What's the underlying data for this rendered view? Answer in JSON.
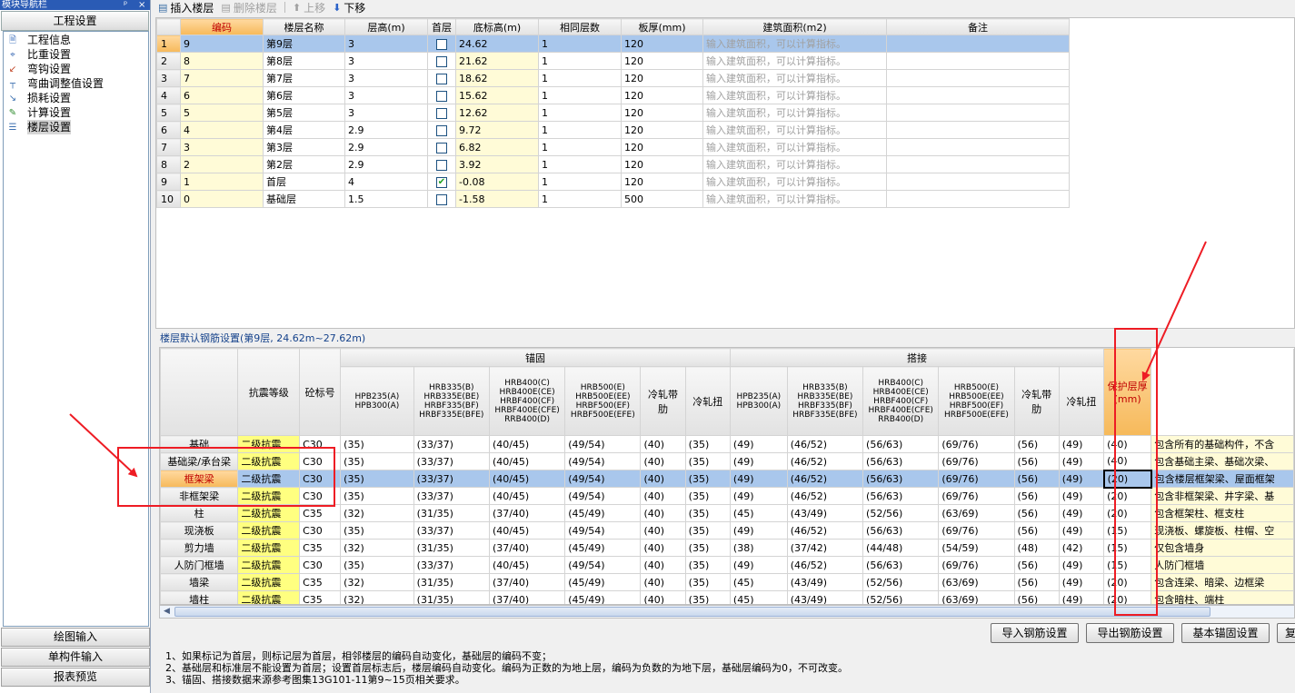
{
  "nav": {
    "title": "模块导航栏",
    "controls": [
      "ᵖ",
      "×"
    ],
    "header": "工程设置",
    "items": [
      {
        "label": "工程信息",
        "icon": "info-icon"
      },
      {
        "label": "比重设置",
        "icon": "ruler-icon"
      },
      {
        "label": "弯钩设置",
        "icon": "hook-icon"
      },
      {
        "label": "弯曲调整值设置",
        "icon": "bend-icon"
      },
      {
        "label": "损耗设置",
        "icon": "loss-icon"
      },
      {
        "label": "计算设置",
        "icon": "calc-icon"
      },
      {
        "label": "楼层设置",
        "icon": "floors-icon"
      }
    ],
    "bottom_buttons": [
      "绘图输入",
      "单构件输入",
      "报表预览"
    ]
  },
  "toolbar": {
    "insert": "插入楼层",
    "delete": "删除楼层",
    "up": "上移",
    "down": "下移"
  },
  "floor_table": {
    "headers": [
      "编码",
      "楼层名称",
      "层高(m)",
      "首层",
      "底标高(m)",
      "相同层数",
      "板厚(mm)",
      "建筑面积(m2)",
      "备注"
    ],
    "rows": [
      {
        "n": "1",
        "code": "9",
        "name": "第9层",
        "height": "3",
        "first": false,
        "base": "24.62",
        "same": "1",
        "slab": "120",
        "area": "输入建筑面积，可以计算指标。",
        "note": ""
      },
      {
        "n": "2",
        "code": "8",
        "name": "第8层",
        "height": "3",
        "first": false,
        "base": "21.62",
        "same": "1",
        "slab": "120",
        "area": "输入建筑面积，可以计算指标。",
        "note": ""
      },
      {
        "n": "3",
        "code": "7",
        "name": "第7层",
        "height": "3",
        "first": false,
        "base": "18.62",
        "same": "1",
        "slab": "120",
        "area": "输入建筑面积，可以计算指标。",
        "note": ""
      },
      {
        "n": "4",
        "code": "6",
        "name": "第6层",
        "height": "3",
        "first": false,
        "base": "15.62",
        "same": "1",
        "slab": "120",
        "area": "输入建筑面积，可以计算指标。",
        "note": ""
      },
      {
        "n": "5",
        "code": "5",
        "name": "第5层",
        "height": "3",
        "first": false,
        "base": "12.62",
        "same": "1",
        "slab": "120",
        "area": "输入建筑面积，可以计算指标。",
        "note": ""
      },
      {
        "n": "6",
        "code": "4",
        "name": "第4层",
        "height": "2.9",
        "first": false,
        "base": "9.72",
        "same": "1",
        "slab": "120",
        "area": "输入建筑面积，可以计算指标。",
        "note": ""
      },
      {
        "n": "7",
        "code": "3",
        "name": "第3层",
        "height": "2.9",
        "first": false,
        "base": "6.82",
        "same": "1",
        "slab": "120",
        "area": "输入建筑面积，可以计算指标。",
        "note": ""
      },
      {
        "n": "8",
        "code": "2",
        "name": "第2层",
        "height": "2.9",
        "first": false,
        "base": "3.92",
        "same": "1",
        "slab": "120",
        "area": "输入建筑面积，可以计算指标。",
        "note": ""
      },
      {
        "n": "9",
        "code": "1",
        "name": "首层",
        "height": "4",
        "first": true,
        "base": "-0.08",
        "same": "1",
        "slab": "120",
        "area": "输入建筑面积，可以计算指标。",
        "note": ""
      },
      {
        "n": "10",
        "code": "0",
        "name": "基础层",
        "height": "1.5",
        "first": false,
        "base": "-1.58",
        "same": "1",
        "slab": "500",
        "area": "输入建筑面积，可以计算指标。",
        "note": ""
      }
    ]
  },
  "rebar": {
    "title": "楼层默认钢筋设置(第9层, 24.62m~27.62m)",
    "group_anchor": "锚固",
    "group_lap": "搭接",
    "col_seismic": "抗震等级",
    "col_concrete": "砼标号",
    "col_cover": "保护层厚(mm)",
    "sub_headers": [
      "HPB235(A) HPB300(A)",
      "HRB335(B) HRB335E(BE) HRBF335(BF) HRBF335E(BFE)",
      "HRB400(C) HRB400E(CE) HRBF400(CF) HRBF400E(CFE) RRB400(D)",
      "HRB500(E) HRB500E(EE) HRBF500(EF) HRBF500E(EFE)",
      "冷轧带肋",
      "冷轧扭"
    ],
    "rows": [
      {
        "cat": "基础",
        "level": "二级抗震",
        "conc": "C30",
        "anchor": [
          "(35)",
          "(33/37)",
          "(40/45)",
          "(49/54)",
          "(40)",
          "(35)"
        ],
        "lap": [
          "(49)",
          "(46/52)",
          "(56/63)",
          "(69/76)",
          "(56)",
          "(49)"
        ],
        "cover": "(40)",
        "note": "包含所有的基础构件，不含"
      },
      {
        "cat": "基础梁/承台梁",
        "level": "二级抗震",
        "conc": "C30",
        "anchor": [
          "(35)",
          "(33/37)",
          "(40/45)",
          "(49/54)",
          "(40)",
          "(35)"
        ],
        "lap": [
          "(49)",
          "(46/52)",
          "(56/63)",
          "(69/76)",
          "(56)",
          "(49)"
        ],
        "cover": "(40)",
        "note": "包含基础主梁、基础次梁、"
      },
      {
        "cat": "框架梁",
        "level": "二级抗震",
        "conc": "C30",
        "anchor": [
          "(35)",
          "(33/37)",
          "(40/45)",
          "(49/54)",
          "(40)",
          "(35)"
        ],
        "lap": [
          "(49)",
          "(46/52)",
          "(56/63)",
          "(69/76)",
          "(56)",
          "(49)"
        ],
        "cover": "(20)",
        "note": "包含楼层框架梁、屋面框架"
      },
      {
        "cat": "非框架梁",
        "level": "二级抗震",
        "conc": "C30",
        "anchor": [
          "(35)",
          "(33/37)",
          "(40/45)",
          "(49/54)",
          "(40)",
          "(35)"
        ],
        "lap": [
          "(49)",
          "(46/52)",
          "(56/63)",
          "(69/76)",
          "(56)",
          "(49)"
        ],
        "cover": "(20)",
        "note": "包含非框架梁、井字梁、基"
      },
      {
        "cat": "柱",
        "level": "二级抗震",
        "conc": "C35",
        "anchor": [
          "(32)",
          "(31/35)",
          "(37/40)",
          "(45/49)",
          "(40)",
          "(35)"
        ],
        "lap": [
          "(45)",
          "(43/49)",
          "(52/56)",
          "(63/69)",
          "(56)",
          "(49)"
        ],
        "cover": "(20)",
        "note": "包含框架柱、框支柱"
      },
      {
        "cat": "现浇板",
        "level": "二级抗震",
        "conc": "C30",
        "anchor": [
          "(35)",
          "(33/37)",
          "(40/45)",
          "(49/54)",
          "(40)",
          "(35)"
        ],
        "lap": [
          "(49)",
          "(46/52)",
          "(56/63)",
          "(69/76)",
          "(56)",
          "(49)"
        ],
        "cover": "(15)",
        "note": "现浇板、螺旋板、柱帽、空"
      },
      {
        "cat": "剪力墙",
        "level": "二级抗震",
        "conc": "C35",
        "anchor": [
          "(32)",
          "(31/35)",
          "(37/40)",
          "(45/49)",
          "(40)",
          "(35)"
        ],
        "lap": [
          "(38)",
          "(37/42)",
          "(44/48)",
          "(54/59)",
          "(48)",
          "(42)"
        ],
        "cover": "(15)",
        "note": "仅包含墙身"
      },
      {
        "cat": "人防门框墙",
        "level": "二级抗震",
        "conc": "C30",
        "anchor": [
          "(35)",
          "(33/37)",
          "(40/45)",
          "(49/54)",
          "(40)",
          "(35)"
        ],
        "lap": [
          "(49)",
          "(46/52)",
          "(56/63)",
          "(69/76)",
          "(56)",
          "(49)"
        ],
        "cover": "(15)",
        "note": "人防门框墙"
      },
      {
        "cat": "墙梁",
        "level": "二级抗震",
        "conc": "C35",
        "anchor": [
          "(32)",
          "(31/35)",
          "(37/40)",
          "(45/49)",
          "(40)",
          "(35)"
        ],
        "lap": [
          "(45)",
          "(43/49)",
          "(52/56)",
          "(63/69)",
          "(56)",
          "(49)"
        ],
        "cover": "(20)",
        "note": "包含连梁、暗梁、边框梁"
      },
      {
        "cat": "墙柱",
        "level": "二级抗震",
        "conc": "C35",
        "anchor": [
          "(32)",
          "(31/35)",
          "(37/40)",
          "(45/49)",
          "(40)",
          "(35)"
        ],
        "lap": [
          "(45)",
          "(43/49)",
          "(52/56)",
          "(63/69)",
          "(56)",
          "(49)"
        ],
        "cover": "(20)",
        "note": "包含暗柱、端柱"
      }
    ]
  },
  "actions": [
    "导入钢筋设置",
    "导出钢筋设置",
    "基本锚固设置",
    "复"
  ],
  "notes": [
    "1、如果标记为首层，则标记层为首层，相邻楼层的编码自动变化，基础层的编码不变；",
    "2、基础层和标准层不能设置为首层；设置首层标志后，楼层编码自动变化。编码为正数的为地上层，编码为负数的为地下层，基础层编码为0，不可改变。",
    "3、锚固、搭接数据来源参考图集13G101-11第9~15页相关要求。"
  ],
  "colors": {
    "annotation": "#ee1c24",
    "selection": "#a9c7ec",
    "highlight_header": "#f6b95a",
    "seismic_cell": "#ffff80"
  }
}
